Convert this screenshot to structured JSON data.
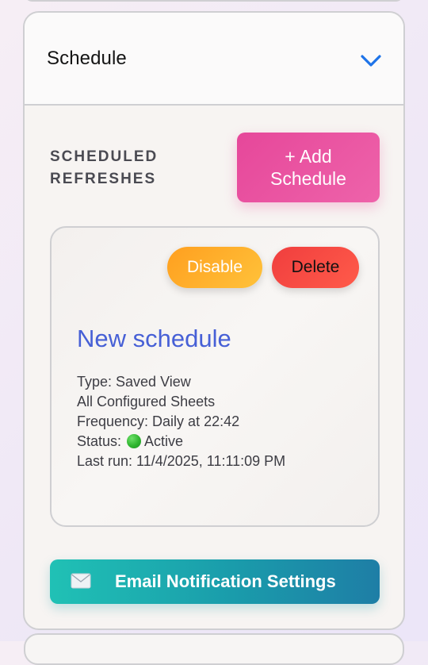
{
  "panel": {
    "title": "Schedule",
    "chevron_icon": "chevron-down-icon"
  },
  "section": {
    "label_line1": "SCHEDULED",
    "label_line2": "REFRESHES",
    "add_button_line1": "+ Add",
    "add_button_line2": "Schedule"
  },
  "schedule": {
    "disable_label": "Disable",
    "delete_label": "Delete",
    "name": "New schedule",
    "type": "Type: Saved View",
    "sheets": "All Configured Sheets",
    "frequency": "Frequency: Daily at 22:42",
    "status_prefix": "Status:",
    "status_icon": "green-circle-icon",
    "status_value": "Active",
    "last_run": "Last run: 11/4/2025, 11:11:09 PM"
  },
  "email": {
    "icon": "envelope-icon",
    "label": "Email Notification Settings"
  },
  "colors": {
    "accent_pink": "#e6479a",
    "title_blue": "#4760d6",
    "disable_orange": "#ffae2a",
    "delete_red": "#f24a43",
    "email_teal": "#20c1b5",
    "chevron_blue": "#1e73e8"
  }
}
